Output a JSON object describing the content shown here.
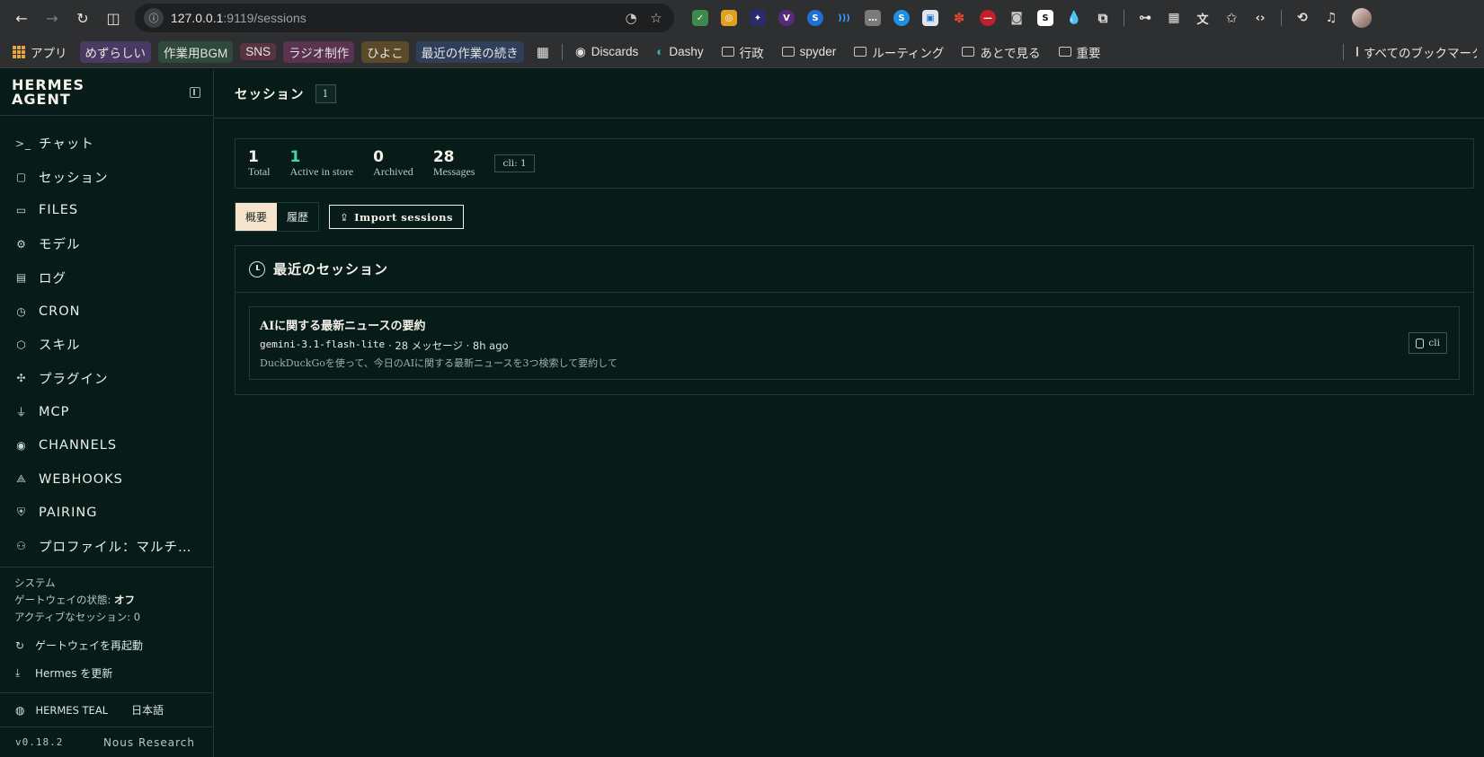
{
  "browser": {
    "url_host": "127.0.0.1",
    "url_path": ":9119/sessions",
    "bookmarks": [
      {
        "label": "アプリ",
        "bg": ""
      },
      {
        "label": "めずらしい",
        "bg": "#4a3a63"
      },
      {
        "label": "作業用BGM",
        "bg": "#2f4a3a"
      },
      {
        "label": "SNS",
        "bg": "#5a3340"
      },
      {
        "label": "ラジオ制作",
        "bg": "#5a3350"
      },
      {
        "label": "ひよこ",
        "bg": "#5a4a2a"
      },
      {
        "label": "最近の作業の続き",
        "bg": "#2f3f5a"
      }
    ],
    "bookmark_links": [
      "Discards",
      "Dashy"
    ],
    "bookmark_folders": [
      "行政",
      "spyder",
      "ルーティング",
      "あとで見る",
      "重要"
    ],
    "all_bookmarks": "すべてのブックマーク"
  },
  "sidebar": {
    "brand": "HERMES\nAGENT",
    "items": [
      {
        "label": "チャット",
        "icon": ">_"
      },
      {
        "label": "セッション",
        "icon": "▢"
      },
      {
        "label": "FILES",
        "icon": "▭"
      },
      {
        "label": "モデル",
        "icon": "⚙"
      },
      {
        "label": "ログ",
        "icon": "▤"
      },
      {
        "label": "CRON",
        "icon": "◷"
      },
      {
        "label": "スキル",
        "icon": "⬡"
      },
      {
        "label": "プラグイン",
        "icon": "✣"
      },
      {
        "label": "MCP",
        "icon": "⏚"
      },
      {
        "label": "CHANNELS",
        "icon": "◉"
      },
      {
        "label": "WEBHOOKS",
        "icon": "⟁"
      },
      {
        "label": "PAIRING",
        "icon": "⛨"
      },
      {
        "label": "プロファイル：マルチエージェント",
        "icon": "⚇"
      }
    ],
    "system": {
      "heading": "システム",
      "gateway_label": "ゲートウェイの状態: ",
      "gateway_value": "オフ",
      "active_label": "アクティブなセッション: ",
      "active_value": "0"
    },
    "restart_gateway": "ゲートウェイを再起動",
    "update_hermes": "Hermes を更新",
    "theme": "HERMES TEAL",
    "language": "日本語",
    "version": "v0.18.2",
    "vendor": "Nous Research"
  },
  "page": {
    "title": "セッション",
    "count": "1",
    "stats": [
      {
        "value": "1",
        "caption": "Total",
        "green": false
      },
      {
        "value": "1",
        "caption": "Active in store",
        "green": true
      },
      {
        "value": "0",
        "caption": "Archived",
        "green": false
      },
      {
        "value": "28",
        "caption": "Messages",
        "green": false
      }
    ],
    "cli_chip": "cli: 1",
    "tab_overview": "概要",
    "tab_history": "履歴",
    "import_label": "Import sessions",
    "recent_title": "最近のセッション",
    "session": {
      "title": "AIに関する最新ニュースの要約",
      "model": "gemini-3.1-flash-lite",
      "meta_rest": "· 28 メッセージ · 8h ago",
      "preview": "DuckDuckGoを使って、今日のAIに関する最新ニュースを3つ検索して要約して",
      "source": "cli"
    }
  }
}
